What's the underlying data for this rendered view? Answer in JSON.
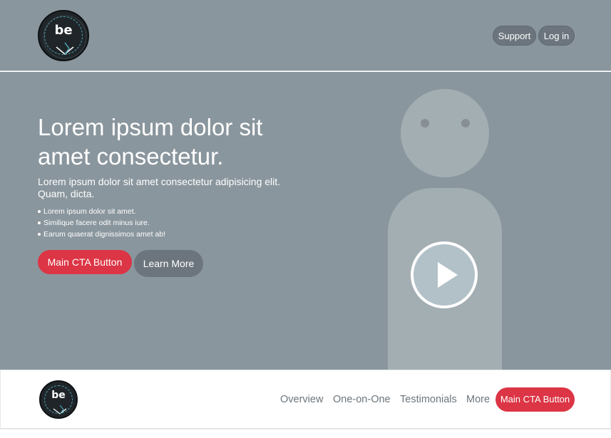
{
  "header": {
    "logo": {
      "initials": "be",
      "ring_text": "IN CODE WE TRUST",
      "icon": "be-badge-logo"
    },
    "support_label": "Support",
    "login_label": "Log in"
  },
  "hero": {
    "title": "Lorem ipsum dolor sit amet consectetur.",
    "subtitle": "Lorem ipsum dolor sit amet consectetur adipisicing elit. Quam, dicta.",
    "bullets": [
      "Lorem ipsum dolor sit amet.",
      "Similique facere odit minus iure.",
      "Earum quaerat dignissimos amet ab!"
    ],
    "cta_label": "Main CTA Button",
    "learn_more_label": "Learn More",
    "media_icon": "play-icon"
  },
  "subnav": {
    "logo": {
      "initials": "be",
      "ring_text": "IN CODE WE TRUST",
      "icon": "be-badge-logo"
    },
    "links": [
      "Overview",
      "One-on-One",
      "Testimonials",
      "More"
    ],
    "cta_label": "Main CTA Button"
  },
  "colors": {
    "hero_bg": "#8a969d",
    "cta_red": "#dc3545",
    "secondary_gray": "#6c757d",
    "placeholder_figure": "#a3aeb3",
    "logo_dark": "#1f2528",
    "logo_accent": "#4f9fb5"
  }
}
